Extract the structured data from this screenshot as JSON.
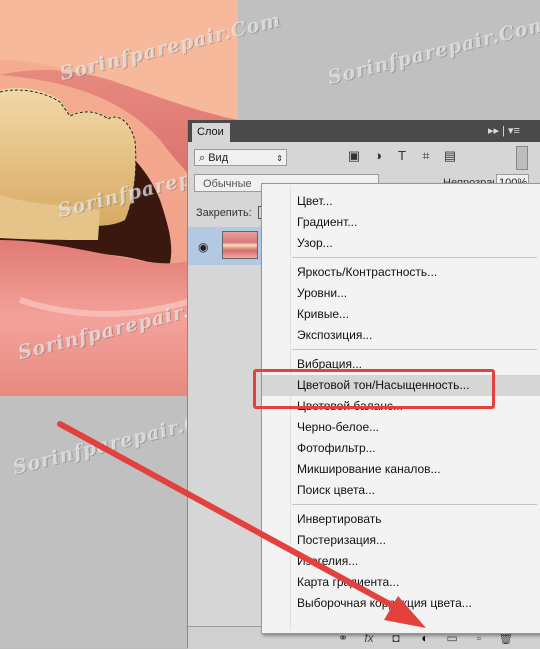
{
  "panel": {
    "tab_label": "Слои",
    "tab_controls": "▸▸ | ▾≡",
    "filter_label": "Вид",
    "blend_mode": "Обычные",
    "opacity_label": "Непрозрачность:",
    "opacity_value": "100%",
    "lock_label": "Закрепить:"
  },
  "menu": {
    "items": [
      "Цвет...",
      "Градиент...",
      "Узор...",
      "Яркость/Контрастность...",
      "Уровни...",
      "Кривые...",
      "Экспозиция...",
      "Вибрация...",
      "Цветовой тон/Насыщенность...",
      "Цветовой баланс...",
      "Черно-белое...",
      "Фотофильтр...",
      "Микширование каналов...",
      "Поиск цвета...",
      "Инвертировать",
      "Постеризация...",
      "Изогелия...",
      "Карта градиента...",
      "Выборочная коррекция цвета..."
    ],
    "highlighted_index": 8
  },
  "watermark": "Sorinfparepair.Com",
  "colors": {
    "annotation_red": "#e2413d",
    "menu_highlight": "#d6d6d6",
    "layer_selected": "#b3c8e2"
  }
}
